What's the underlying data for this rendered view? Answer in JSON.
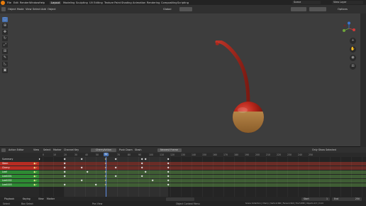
{
  "menubar": {
    "menus": [
      "File",
      "Edit",
      "Render",
      "Window",
      "Help"
    ],
    "workspaces": [
      "Layout",
      "Modeling",
      "Sculpting",
      "UV Editing",
      "Texture Paint",
      "Shading",
      "Animation",
      "Rendering",
      "Compositing",
      "Scripting"
    ],
    "active_workspace": "Layout",
    "scene": "Scene",
    "view_layer": "View Layer"
  },
  "viewport_header": {
    "mode": "Object Mode",
    "menus": [
      "View",
      "Select",
      "Add",
      "Object"
    ],
    "transform_orientation": "Global",
    "options_label": "Options"
  },
  "timeline_header": {
    "editor": "Action Editor",
    "menus": [
      "View",
      "Select",
      "Marker",
      "Channel",
      "Key"
    ],
    "action_name": "CherryAction",
    "push_down": "Push Down",
    "stash": "Stash",
    "interpolation": "Nearest Frame",
    "mode": "Only Show Selected"
  },
  "ruler": {
    "frames": [
      "0",
      "10",
      "20",
      "30",
      "40",
      "50",
      "60",
      "70",
      "80",
      "90",
      "100",
      "110",
      "120",
      "130",
      "140",
      "150",
      "160",
      "170",
      "180",
      "190",
      "200",
      "210",
      "220",
      "230",
      "240",
      "250"
    ],
    "current_frame": "62"
  },
  "channels": [
    {
      "name": "Summary",
      "kind": "summary"
    },
    {
      "name": "Stem",
      "kind": "red"
    },
    {
      "name": "Cherry",
      "kind": "red"
    },
    {
      "name": "Leaf",
      "kind": "green"
    },
    {
      "name": "Leaf.001",
      "kind": "green"
    },
    {
      "name": "Leaf.002",
      "kind": "green"
    },
    {
      "name": "Leaf.003",
      "kind": "green"
    }
  ],
  "keyframe_rows": [
    [
      0,
      36,
      60,
      94,
      108,
      145,
      150,
      182
    ],
    [
      36,
      94,
      145,
      182
    ],
    [
      36,
      60,
      94,
      108,
      145,
      182
    ],
    [
      36,
      68,
      94,
      150,
      182
    ],
    [
      36,
      94,
      108,
      145,
      182
    ],
    [
      60,
      94,
      160,
      182
    ],
    [
      36,
      80,
      94,
      182
    ]
  ],
  "selected_keys_column": 94,
  "footer": {
    "playback": "Playback",
    "keying": "Keying",
    "view": "View",
    "marker": "Marker",
    "start_label": "Start",
    "start": "1",
    "end_label": "End",
    "end": "250"
  },
  "statusbar": {
    "left": "Select",
    "middle_a": "Box Select",
    "middle_b": "Pan View",
    "middle_c": "Object Context Menu",
    "right": "Scene Collection | Cherry | Verts:2,960 | Faces:2,944 | Tris:5,888 | Objects:1/3 | 3.0.0"
  },
  "colors": {
    "accent": "#4772b3",
    "channel_red": "#b82c22",
    "channel_green": "#2e8b33",
    "cherry": "#b8261b",
    "cherry_base": "#b5813f",
    "stem": "#a6271d"
  },
  "icons": {
    "blender_logo": "blender-logo-icon",
    "cursor": "cursor-icon",
    "move": "move-icon",
    "rotate": "rotate-icon",
    "scale": "scale-icon",
    "transform": "transform-icon",
    "annotate": "annotate-icon",
    "measure": "measure-icon",
    "add_cube": "add-cube-icon"
  }
}
